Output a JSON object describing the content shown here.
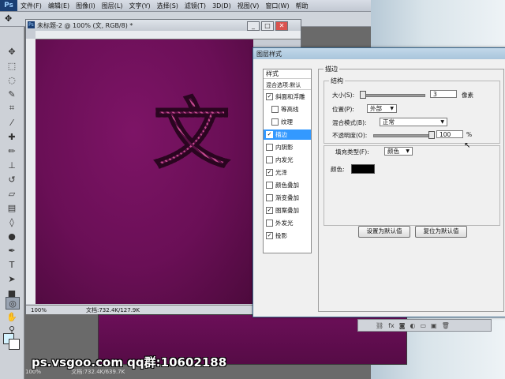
{
  "menu": {
    "logo": "Ps",
    "items": [
      "文件(F)",
      "编辑(E)",
      "图像(I)",
      "图层(L)",
      "文字(Y)",
      "选择(S)",
      "滤镜(T)",
      "3D(D)",
      "视图(V)",
      "窗口(W)",
      "帮助"
    ]
  },
  "document": {
    "title": "未标题-2 @ 100% (文, RGB/8) *",
    "glyph": "文",
    "zoom": "100%",
    "doc_info": "文档:732.4K/127.9K",
    "glyph_color": "#c44a8e",
    "canvas_color": "#6a0f56"
  },
  "document2": {
    "zoom": "100%",
    "doc_info": "文档:732.4K/639.7K"
  },
  "watermark": "ps.vsgoo.com qq群:10602188",
  "dialog": {
    "title": "图层样式",
    "style_list": {
      "header": "样式",
      "blend_header": "混合选项:默认",
      "items": [
        {
          "label": "斜面和浮雕",
          "checked": true
        },
        {
          "label": "等高线",
          "checked": false,
          "indent": true
        },
        {
          "label": "纹理",
          "checked": false,
          "indent": true
        },
        {
          "label": "描边",
          "checked": true,
          "selected": true
        },
        {
          "label": "内阴影",
          "checked": false
        },
        {
          "label": "内发光",
          "checked": false
        },
        {
          "label": "光泽",
          "checked": true
        },
        {
          "label": "颜色叠加",
          "checked": false
        },
        {
          "label": "渐变叠加",
          "checked": false
        },
        {
          "label": "图案叠加",
          "checked": true
        },
        {
          "label": "外发光",
          "checked": false
        },
        {
          "label": "投影",
          "checked": true
        }
      ]
    },
    "stroke": {
      "section_title": "描边",
      "structure_title": "结构",
      "size_label": "大小(S):",
      "size_value": "3",
      "size_unit": "像素",
      "size_fraction": 0.01,
      "position_label": "位置(P):",
      "position_value": "外部",
      "blend_label": "混合模式(B):",
      "blend_value": "正常",
      "opacity_label": "不透明度(O):",
      "opacity_value": "100",
      "opacity_unit": "%",
      "opacity_fraction": 1.0,
      "fill_type_label": "填充类型(F):",
      "fill_type_value": "颜色",
      "color_label": "颜色:",
      "color_value": "#000000"
    },
    "buttons": {
      "set_default": "设置为默认值",
      "reset_default": "复位为默认值"
    }
  }
}
